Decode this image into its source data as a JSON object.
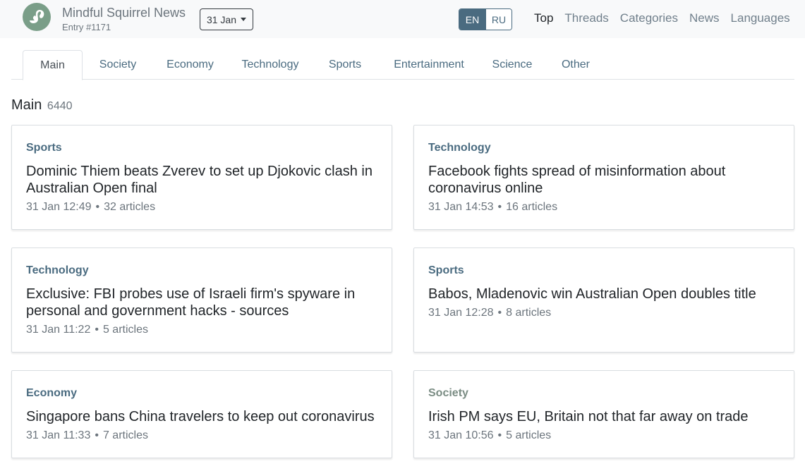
{
  "header": {
    "brand_name": "Mindful Squirrel News",
    "brand_sub": "Entry #1171",
    "date_button": "31 Jan",
    "languages": [
      "EN",
      "RU"
    ],
    "active_language": "EN",
    "nav": [
      "Top",
      "Threads",
      "Categories",
      "News",
      "Languages"
    ],
    "active_nav": "Top"
  },
  "tabs": [
    "Main",
    "Society",
    "Economy",
    "Technology",
    "Sports",
    "Entertainment",
    "Science",
    "Other"
  ],
  "active_tab": "Main",
  "section": {
    "title": "Main",
    "count": "6440"
  },
  "cards": [
    {
      "category": "Sports",
      "title": "Dominic Thiem beats Zverev to set up Djokovic clash in Australian Open final",
      "time": "31 Jan 12:49",
      "articles": "32 articles"
    },
    {
      "category": "Technology",
      "title": "Facebook fights spread of misinformation about coronavirus online",
      "time": "31 Jan 14:53",
      "articles": "16 articles"
    },
    {
      "category": "Technology",
      "title": "Exclusive: FBI probes use of Israeli firm's spyware in personal and government hacks - sources",
      "time": "31 Jan 11:22",
      "articles": "5 articles"
    },
    {
      "category": "Sports",
      "title": "Babos, Mladenovic win Australian Open doubles title",
      "time": "31 Jan 12:28",
      "articles": "8 articles"
    },
    {
      "category": "Economy",
      "title": "Singapore bans China travelers to keep out coronavirus",
      "time": "31 Jan 11:33",
      "articles": "7 articles"
    },
    {
      "category": "Society",
      "title": "Irish PM says EU, Britain not that far away on trade",
      "time": "31 Jan 10:56",
      "articles": "5 articles"
    }
  ],
  "separator": "•",
  "colors": {
    "accent": "#4a6b80",
    "logo": "#7a9e88",
    "society": "#7b8d84"
  },
  "icons": {
    "logo": "squirrel-icon",
    "dropdown": "caret-down-icon"
  }
}
